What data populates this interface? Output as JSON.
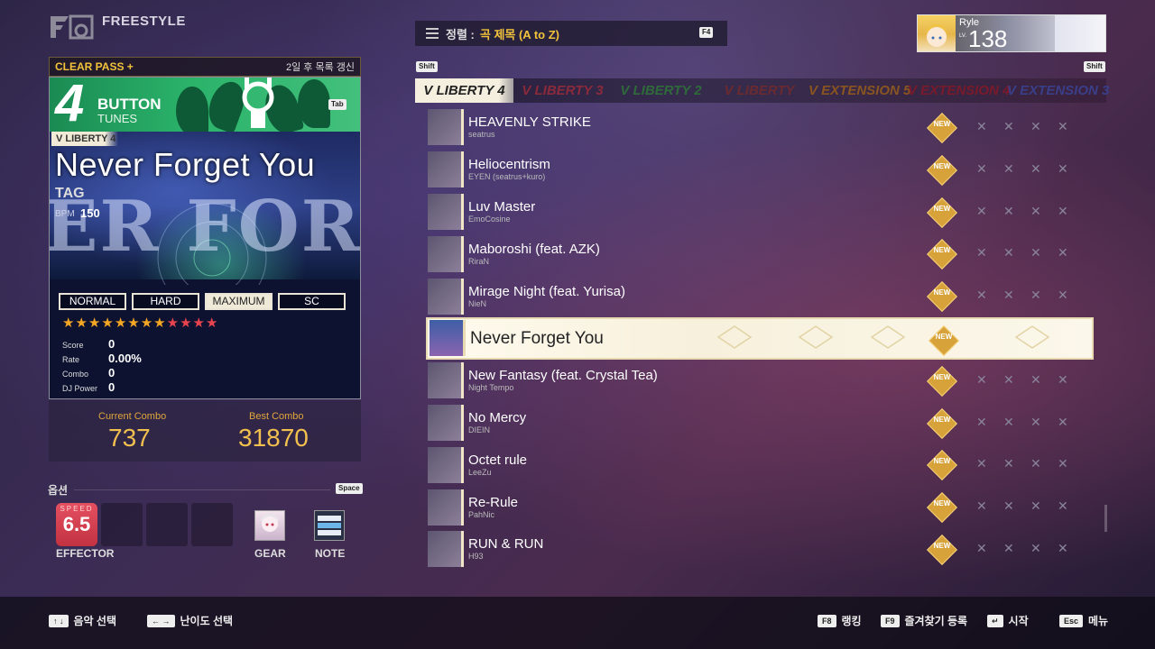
{
  "header": {
    "mode": "FREESTYLE"
  },
  "left_panel": {
    "clear_pass": "CLEAR PASS +",
    "refresh_notice": "2일 후 목록 갱신",
    "button_count": "4",
    "button_word": "BUTTON",
    "button_sub": "TUNES",
    "tab_key": "Tab",
    "version_badge": "V LIBERTY 4",
    "art_text": "ER FORGET Y",
    "song_title": "Never Forget You",
    "artist": "TAG",
    "bpm_label": "BPM",
    "bpm": "150",
    "difficulties": [
      "NORMAL",
      "HARD",
      "MAXIMUM",
      "SC"
    ],
    "selected_difficulty": "MAXIMUM",
    "stars": {
      "orange": 8,
      "red": 4
    },
    "stats": [
      {
        "label": "Score",
        "value": "0"
      },
      {
        "label": "Rate",
        "value": "0.00%"
      },
      {
        "label": "Combo",
        "value": "0"
      },
      {
        "label": "DJ Power",
        "value": "0"
      }
    ],
    "current_combo_label": "Current Combo",
    "current_combo": "737",
    "best_combo_label": "Best Combo",
    "best_combo": "31870"
  },
  "options": {
    "label": "옵션",
    "space_key": "Space",
    "speed_label": "SPEED",
    "speed": "6.5",
    "effector_label": "EFFECTOR",
    "gear_label": "GEAR",
    "note_label": "NOTE"
  },
  "sort": {
    "label": "정렬 :",
    "value": "곡 제목 (A to Z)",
    "key": "F4"
  },
  "profile": {
    "name": "Ryle",
    "lv_label": "LV.",
    "level": "138"
  },
  "tabs": {
    "shift_left": "Shift",
    "shift_right": "Shift",
    "items": [
      {
        "label": "V LIBERTY 4",
        "color": "#222222"
      },
      {
        "label": "V LIBERTY 3",
        "color": "#8a2a3a"
      },
      {
        "label": "V LIBERTY 2",
        "color": "#2f6b3a"
      },
      {
        "label": "V LIBERTY",
        "color": "#6a2a30"
      },
      {
        "label": "V EXTENSION 5",
        "color": "#8a5520"
      },
      {
        "label": "V EXTENSION 4",
        "color": "#7a1a2a"
      },
      {
        "label": "V EXTENSION 3",
        "color": "#3a3f8a"
      }
    ]
  },
  "badge": {
    "top": "DJ MAX",
    "bottom": "NEW"
  },
  "cross_glyph": "✕",
  "songs": [
    {
      "title": "HEAVENLY STRIKE",
      "artist": "seatrus"
    },
    {
      "title": "Heliocentrism",
      "artist": "EYEN (seatrus+kuro)"
    },
    {
      "title": "Luv Master",
      "artist": "EmoCosine"
    },
    {
      "title": "Maboroshi (feat. AZK)",
      "artist": "RiraN"
    },
    {
      "title": "Mirage Night (feat. Yurisa)",
      "artist": "NieN"
    },
    {
      "title": "Never Forget You",
      "artist": ""
    },
    {
      "title": "New Fantasy (feat. Crystal Tea)",
      "artist": "Night Tempo"
    },
    {
      "title": "No Mercy",
      "artist": "DIEIN"
    },
    {
      "title": "Octet rule",
      "artist": "LeeZu"
    },
    {
      "title": "Re-Rule",
      "artist": "PahNic"
    },
    {
      "title": "RUN & RUN",
      "artist": "H93"
    }
  ],
  "selected_song_index": 5,
  "footer": {
    "music_select_keys": "↑ ↓",
    "music_select": "음악 선택",
    "difficulty_keys": "← →",
    "difficulty_select": "난이도 선택",
    "ranking_key": "F8",
    "ranking": "랭킹",
    "favorite_key": "F9",
    "favorite": "즐겨찾기 등록",
    "start_key": "↵",
    "start": "시작",
    "menu_key": "Esc",
    "menu": "메뉴"
  }
}
